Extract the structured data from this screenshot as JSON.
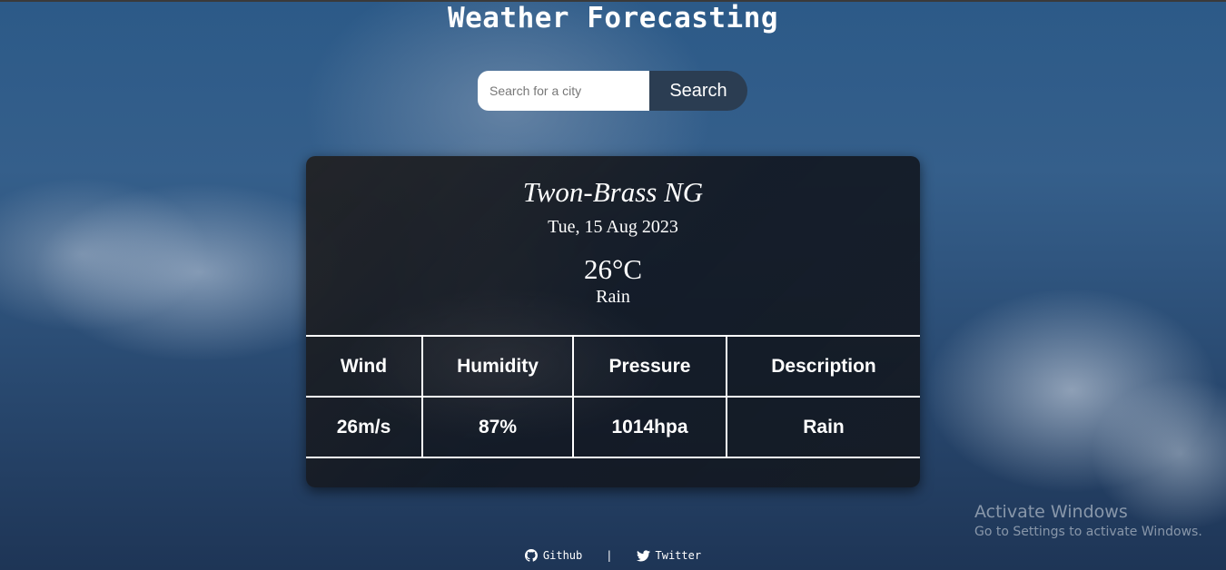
{
  "header": {
    "title": "Weather Forecasting"
  },
  "search": {
    "placeholder": "Search for a city",
    "value": "",
    "button_label": "Search"
  },
  "weather": {
    "city": "Twon-Brass NG",
    "date": "Tue, 15 Aug 2023",
    "temperature": "26°C",
    "condition": "Rain"
  },
  "stats": {
    "headers": [
      "Wind",
      "Humidity",
      "Pressure",
      "Description"
    ],
    "values": [
      "26m/s",
      "87%",
      "1014hpa",
      "Rain"
    ]
  },
  "footer": {
    "links": [
      {
        "label": "Github",
        "icon": "github-icon"
      },
      {
        "label": "Twitter",
        "icon": "twitter-icon"
      }
    ],
    "separator": "|"
  },
  "os_overlay": {
    "line1": "Activate Windows",
    "line2": "Go to Settings to activate Windows."
  },
  "colors": {
    "search_button": "#2b3d52",
    "card_bg": "#16191f",
    "text": "#ffffff"
  }
}
